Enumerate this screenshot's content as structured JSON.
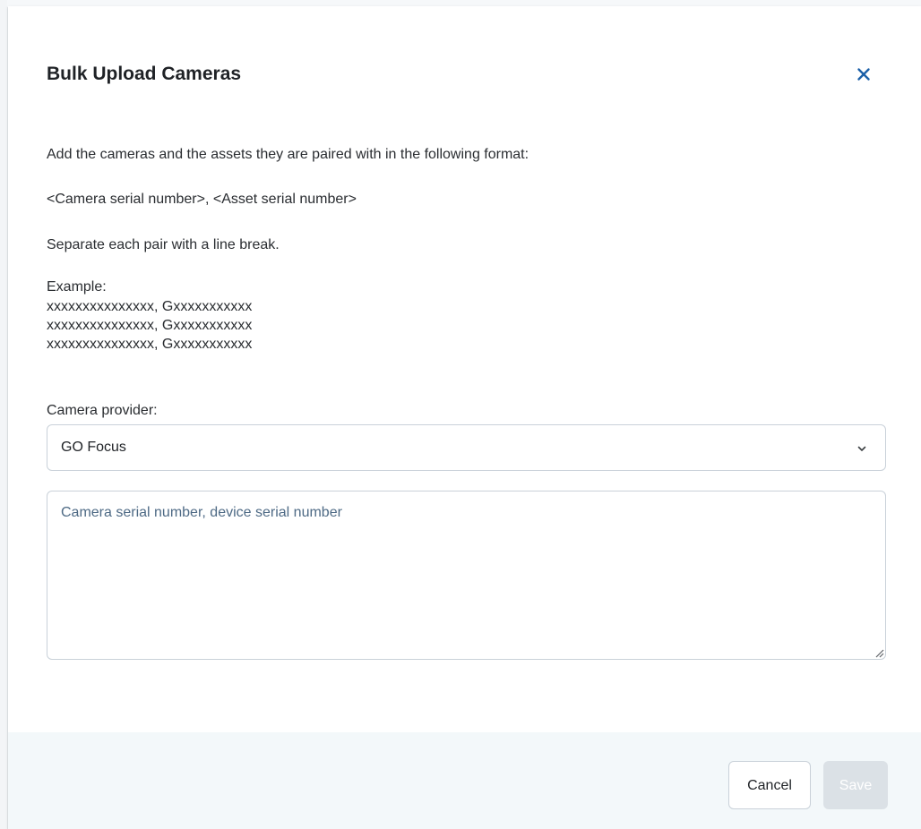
{
  "dialog": {
    "title": "Bulk Upload Cameras",
    "close_icon": "close-icon"
  },
  "instructions": {
    "line1": "Add the cameras and the assets they are paired with in the following format:",
    "line2": "<Camera serial number>, <Asset serial number>",
    "line3": "Separate each pair with a line break.",
    "example_heading": "Example:",
    "example_lines": [
      "xxxxxxxxxxxxxxx, Gxxxxxxxxxxx",
      "xxxxxxxxxxxxxxx, Gxxxxxxxxxxx",
      "xxxxxxxxxxxxxxx, Gxxxxxxxxxxx"
    ]
  },
  "provider": {
    "label": "Camera provider:",
    "selected": "GO Focus",
    "chevron_icon": "chevron-down-icon"
  },
  "serials_input": {
    "value": "",
    "placeholder": "Camera serial number, device serial number"
  },
  "footer": {
    "cancel_label": "Cancel",
    "save_label": "Save"
  },
  "colors": {
    "accent": "#1a5fa8",
    "placeholder": "#4e6a85",
    "footer_bg": "#f3f8fa",
    "save_disabled_bg": "#dbe1e6",
    "border": "#c9d1d9"
  }
}
